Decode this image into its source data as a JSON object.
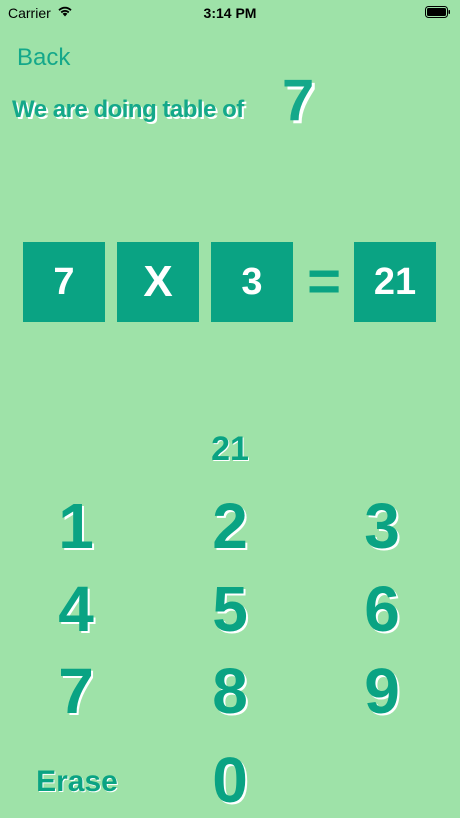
{
  "status_bar": {
    "carrier": "Carrier",
    "time": "3:14 PM",
    "wifi_icon": "wifi-icon",
    "battery_icon": "battery-icon"
  },
  "nav": {
    "back_label": "Back"
  },
  "header": {
    "title": "We are doing table of",
    "table_number": "7"
  },
  "equation": {
    "operand_a": "7",
    "operator": "X",
    "operand_b": "3",
    "equals": "=",
    "result": "21"
  },
  "answer": {
    "value": "21"
  },
  "keypad": {
    "keys": [
      "1",
      "2",
      "3",
      "4",
      "5",
      "6",
      "7",
      "8",
      "9"
    ],
    "zero": "0",
    "erase_label": "Erase"
  },
  "colors": {
    "background": "#9ee2a8",
    "accent": "#0aa383",
    "text_shadow": "#ffffff"
  }
}
